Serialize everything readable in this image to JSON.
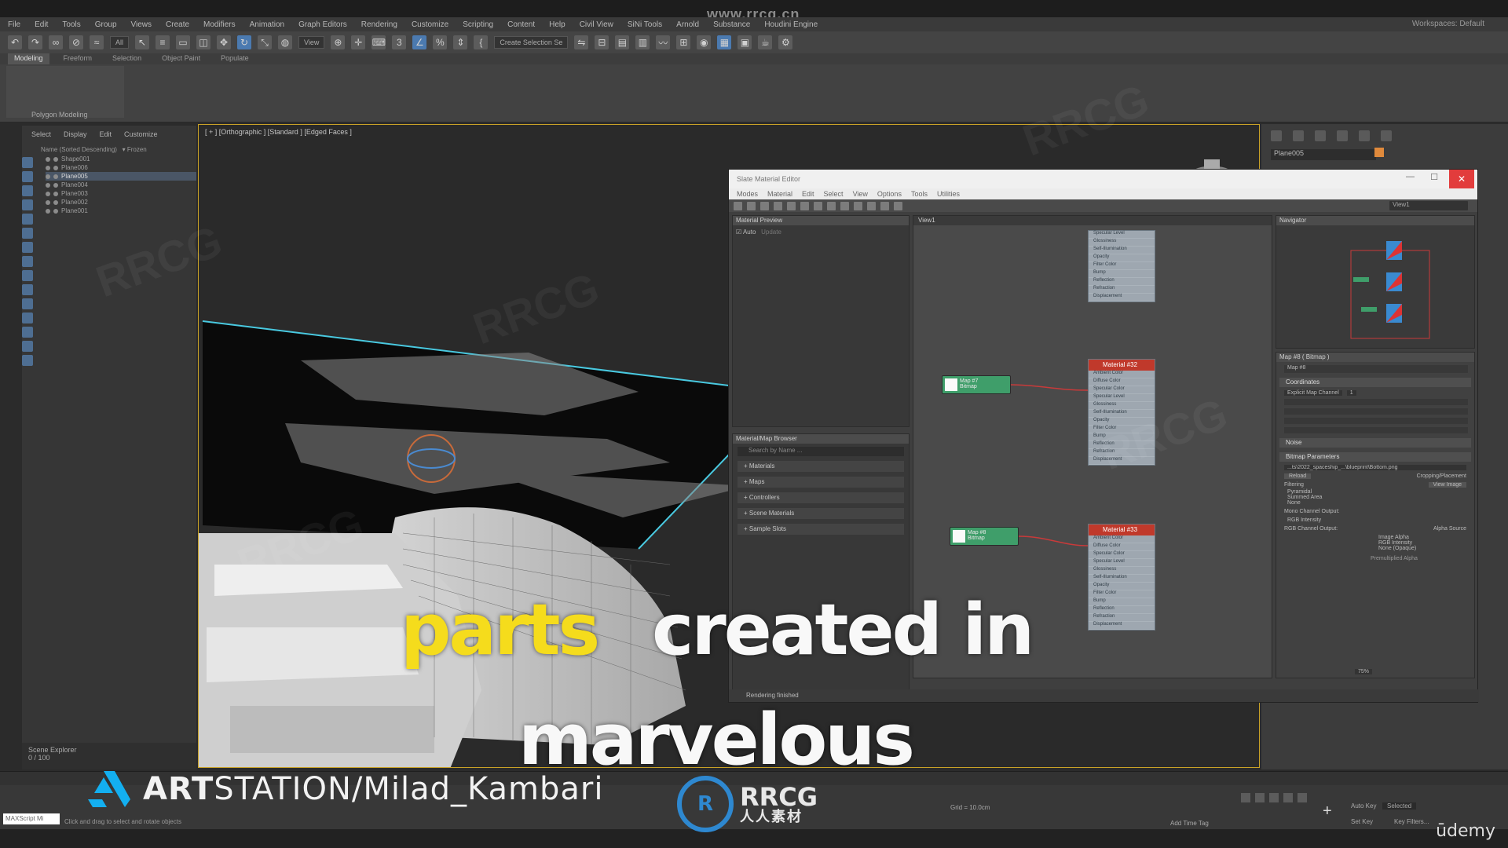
{
  "site_watermark": "www.rrcg.cn",
  "menubar": {
    "items": [
      "File",
      "Edit",
      "Tools",
      "Group",
      "Views",
      "Create",
      "Modifiers",
      "Animation",
      "Graph Editors",
      "Rendering",
      "Customize",
      "Scripting",
      "Content",
      "Help",
      "Civil View",
      "SiNi Tools",
      "Arnold",
      "Substance",
      "Houdini Engine"
    ],
    "workspace": "Workspaces: Default"
  },
  "toolbar": {
    "selection_filter": "All",
    "view_drop": "View",
    "selection_set": "Create Selection Se"
  },
  "ribbon": {
    "tabs": [
      "Modeling",
      "Freeform",
      "Selection",
      "Object Paint",
      "Populate"
    ],
    "active_tab": "Modeling",
    "group_label": "Polygon Modeling"
  },
  "scene_explorer": {
    "tabs": [
      "Select",
      "Display",
      "Edit",
      "Customize"
    ],
    "column_header": "Name (Sorted Descending)",
    "column_frozen": "Frozen",
    "rows": [
      {
        "name": "Shape001",
        "selected": false
      },
      {
        "name": "Plane006",
        "selected": false
      },
      {
        "name": "Plane005",
        "selected": true
      },
      {
        "name": "Plane004",
        "selected": false
      },
      {
        "name": "Plane003",
        "selected": false
      },
      {
        "name": "Plane002",
        "selected": false
      },
      {
        "name": "Plane001",
        "selected": false
      }
    ],
    "footer_label": "Scene Explorer",
    "footer_frames": "0 / 100"
  },
  "viewport": {
    "label": "[ + ] [Orthographic ] [Standard ] [Edged Faces ]"
  },
  "command_panel": {
    "object_name": "Plane005",
    "swatch_color": "#e08a3c"
  },
  "slate_editor": {
    "title": "Slate Material Editor",
    "menu": [
      "Modes",
      "Material",
      "Edit",
      "Select",
      "View",
      "Options",
      "Tools",
      "Utilities"
    ],
    "view_drop": "View1",
    "material_preview": {
      "title": "Material Preview",
      "auto_label": "Auto",
      "update_label": "Update"
    },
    "browser": {
      "title": "Material/Map Browser",
      "search_placeholder": "Search by Name ...",
      "items": [
        "+ Materials",
        "+ Maps",
        "+ Controllers",
        "+ Scene Materials",
        "+ Sample Slots"
      ]
    },
    "view_tab": "View1",
    "nodes": {
      "top": {
        "rows": [
          "Specular Level",
          "Glossiness",
          "Self-Illumination",
          "Opacity",
          "Filter Color",
          "Bump",
          "Reflection",
          "Refraction",
          "Displacement"
        ]
      },
      "mid": {
        "title": "Material #32",
        "rows": [
          "Ambient Color",
          "Diffuse Color",
          "Specular Color",
          "Specular Level",
          "Glossiness",
          "Self-Illumination",
          "Opacity",
          "Filter Color",
          "Bump",
          "Reflection",
          "Refraction",
          "Displacement"
        ]
      },
      "bottom": {
        "title": "Material #33",
        "rows": [
          "Ambient Color",
          "Diffuse Color",
          "Specular Color",
          "Specular Level",
          "Glossiness",
          "Self-Illumination",
          "Opacity",
          "Filter Color",
          "Bump",
          "Reflection",
          "Refraction",
          "Displacement"
        ]
      },
      "map1": {
        "line1": "Map #7",
        "line2": "Bitmap"
      },
      "map2": {
        "line1": "Map #8",
        "line2": "Bitmap"
      }
    },
    "navigator_title": "Navigator",
    "params": {
      "title": "Map #8 ( Bitmap )",
      "name_field": "Map #8",
      "sections": [
        "Coordinates",
        "Noise",
        "Bitmap Parameters"
      ],
      "mapping": "Explicit Map Channel",
      "map_channel": "1",
      "bitmap_path": "...ts\\2022_spaceship_...\\blueprint\\Bottom.png",
      "reload": "Reload",
      "cropping": "Cropping/Placement",
      "view_image": "View Image",
      "filtering": "Filtering",
      "filter_options": [
        "Pyramidal",
        "Summed Area",
        "None"
      ],
      "mono_output": "Mono Channel Output:",
      "rgb_intensity": "RGB Intensity",
      "rgb_output": "RGB Channel Output:",
      "alpha_source": "Alpha Source",
      "alpha_options": [
        "Image Alpha",
        "RGB Intensity",
        "None (Opaque)"
      ],
      "premultiplied": "Premultiplied Alpha",
      "zoom": "75%"
    },
    "status": "Rendering finished"
  },
  "statusbar": {
    "maxscript": "MAXScript Mi",
    "prompt": "Click and drag to select and rotate objects",
    "grid": "Grid = 10.0cm",
    "add_time_tag": "Add Time Tag",
    "autokey": "Auto Key",
    "selected": "Selected",
    "set_key": "Set Key",
    "key_filters": "Key Filters..."
  },
  "overlay": {
    "caption_yellow": "parts",
    "caption_white_1": "created in",
    "caption_white_2": "marvelous",
    "artstation_bold": "ART",
    "artstation_rest": "STATION/Milad_Kambari",
    "rrcg_big": "RRCG",
    "rrcg_small": "人人素材",
    "rrcg_mark": "R",
    "udemy": "ūdemy"
  }
}
